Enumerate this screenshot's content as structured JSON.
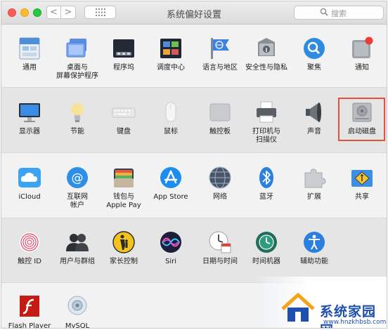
{
  "window": {
    "title": "系统偏好设置",
    "search_placeholder": "搜索",
    "back_glyph": "<",
    "forward_glyph": ">"
  },
  "rows": [
    [
      {
        "label": "通用",
        "icon": "general-icon"
      },
      {
        "label": "桌面与\n屏幕保护程序",
        "icon": "desktop-screensaver-icon"
      },
      {
        "label": "程序坞",
        "icon": "dock-icon"
      },
      {
        "label": "调度中心",
        "icon": "mission-control-icon"
      },
      {
        "label": "语言与地区",
        "icon": "language-region-icon"
      },
      {
        "label": "安全性与隐私",
        "icon": "security-privacy-icon"
      },
      {
        "label": "聚焦",
        "icon": "spotlight-icon"
      },
      {
        "label": "通知",
        "icon": "notifications-icon"
      }
    ],
    [
      {
        "label": "显示器",
        "icon": "displays-icon"
      },
      {
        "label": "节能",
        "icon": "energy-saver-icon"
      },
      {
        "label": "键盘",
        "icon": "keyboard-icon"
      },
      {
        "label": "鼠标",
        "icon": "mouse-icon"
      },
      {
        "label": "触控板",
        "icon": "trackpad-icon"
      },
      {
        "label": "打印机与\n扫描仪",
        "icon": "printers-scanners-icon"
      },
      {
        "label": "声音",
        "icon": "sound-icon"
      },
      {
        "label": "启动磁盘",
        "icon": "startup-disk-icon"
      }
    ],
    [
      {
        "label": "iCloud",
        "icon": "icloud-icon"
      },
      {
        "label": "互联网\n帐户",
        "icon": "internet-accounts-icon"
      },
      {
        "label": "钱包与\nApple Pay",
        "icon": "wallet-applepay-icon"
      },
      {
        "label": "App Store",
        "icon": "app-store-icon"
      },
      {
        "label": "网络",
        "icon": "network-icon"
      },
      {
        "label": "蓝牙",
        "icon": "bluetooth-icon"
      },
      {
        "label": "扩展",
        "icon": "extensions-icon"
      },
      {
        "label": "共享",
        "icon": "sharing-icon"
      }
    ],
    [
      {
        "label": "触控 ID",
        "icon": "touch-id-icon"
      },
      {
        "label": "用户与群组",
        "icon": "users-groups-icon"
      },
      {
        "label": "家长控制",
        "icon": "parental-controls-icon"
      },
      {
        "label": "Siri",
        "icon": "siri-icon"
      },
      {
        "label": "日期与时间",
        "icon": "date-time-icon"
      },
      {
        "label": "时间机器",
        "icon": "time-machine-icon"
      },
      {
        "label": "辅助功能",
        "icon": "accessibility-icon"
      }
    ],
    [
      {
        "label": "Flash Player",
        "icon": "flash-player-icon"
      },
      {
        "label": "MySQL",
        "icon": "mysql-icon"
      }
    ]
  ],
  "watermark": {
    "name": "系统家园网",
    "url": "www.hnzkhbsb.com"
  },
  "colors": {
    "highlight_border": "#e0523c",
    "watermark_blue": "#1e4fb0"
  }
}
